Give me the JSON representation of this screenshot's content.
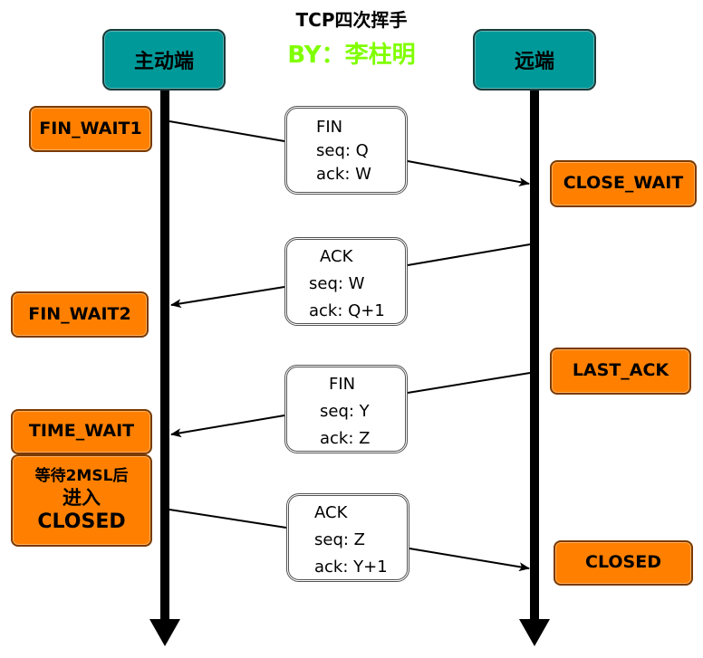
{
  "title": "TCP四次挥手",
  "subtitle": "BY：李柱明",
  "parties": {
    "client": "主动端",
    "server": "远端"
  },
  "client_states": [
    "FIN_WAIT1",
    "FIN_WAIT2",
    "TIME_WAIT"
  ],
  "client_closed_note": [
    "等待2MSL后",
    "进入",
    "CLOSED"
  ],
  "server_states": [
    "CLOSE_WAIT",
    "LAST_ACK",
    "CLOSED"
  ],
  "messages": [
    {
      "type": "FIN",
      "seq": "seq: Q",
      "ack": "ack: W",
      "direction": "client-to-server"
    },
    {
      "type": "ACK",
      "seq": "seq: W",
      "ack": "ack: Q+1",
      "direction": "server-to-client"
    },
    {
      "type": "FIN",
      "seq": "seq: Y",
      "ack": "ack: Z",
      "direction": "server-to-client"
    },
    {
      "type": "ACK",
      "seq": "seq: Z",
      "ack": "ack: Y+1",
      "direction": "client-to-server"
    }
  ],
  "colors": {
    "party_box": "#009999",
    "state_box": "#ff8000",
    "subtitle": "#80ff00"
  }
}
